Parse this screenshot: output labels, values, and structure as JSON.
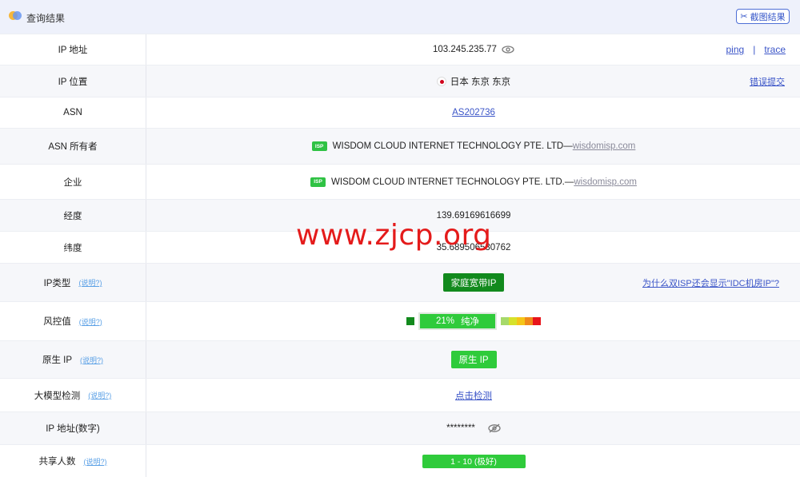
{
  "header": {
    "title": "查询结果",
    "screenshot_button": "截图结果",
    "screenshot_icon": "scissors-icon"
  },
  "rows": {
    "ip": {
      "label": "IP 地址",
      "value": "103.245.235.77",
      "ping": "ping",
      "sep": "|",
      "trace": "trace"
    },
    "location": {
      "label": "IP 位置",
      "flag": "JP",
      "value": "日本 东京 东京",
      "report": "错误提交"
    },
    "asn": {
      "label": "ASN",
      "value": "AS202736"
    },
    "asn_owner": {
      "label": "ASN 所有者",
      "badge": "ISP",
      "value": "WISDOM CLOUD INTERNET TECHNOLOGY PTE. LTD— ",
      "domain": "wisdomisp.com"
    },
    "company": {
      "label": "企业",
      "badge": "ISP",
      "value": "WISDOM CLOUD INTERNET TECHNOLOGY PTE. LTD.— ",
      "domain": "wisdomisp.com"
    },
    "longitude": {
      "label": "经度",
      "value": "139.69169616699"
    },
    "latitude": {
      "label": "纬度",
      "value": "35.689506530762"
    },
    "ip_type": {
      "label": "IP类型",
      "help": "(说明?)",
      "value": "家庭宽带IP",
      "note": "为什么双ISP还会显示\"IDC机房IP\"?"
    },
    "risk": {
      "label": "风控值",
      "help": "(说明?)",
      "percent": "21%",
      "text": "纯净",
      "level": 0.21
    },
    "native": {
      "label": "原生 IP",
      "help": "(说明?)",
      "value": "原生 IP"
    },
    "llm": {
      "label": "大模型检测",
      "help": "(说明?)",
      "value": "点击检测"
    },
    "ip_numeric": {
      "label": "IP 地址(数字)",
      "value": "********",
      "icon": "eye-off-icon"
    },
    "shared": {
      "label": "共享人数",
      "help": "(说明?)",
      "value": "1 - 10 (极好)"
    }
  },
  "watermark": "www.zjcp.org",
  "colors": {
    "accent": "#3b55c8",
    "green": "#2fcb3b",
    "dark_green": "#128a1d",
    "risk_scale": [
      "#a6d96a",
      "#d6e22b",
      "#f5c518",
      "#f08a1a",
      "#e8141b"
    ]
  }
}
